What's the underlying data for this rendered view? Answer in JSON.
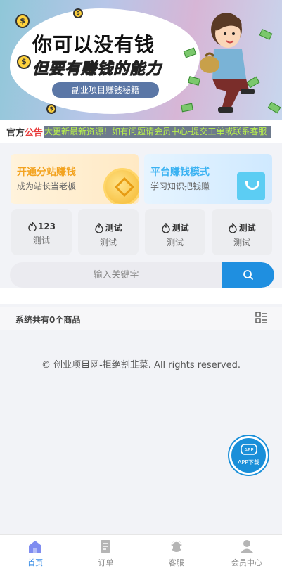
{
  "banner": {
    "title_line1": "你可以没有钱",
    "title_line2": "但要有赚钱的能力",
    "pill": "副业项目赚钱秘籍",
    "coin_symbol": "$"
  },
  "notice": {
    "tag_part1": "官方",
    "tag_part2": "公告",
    "text": "大更新最新资源！如有问题请会员中心-提交工单或联系客服"
  },
  "cards": [
    {
      "title": "开通分站赚钱",
      "subtitle": "成为站长当老板"
    },
    {
      "title": "平台赚钱模式",
      "subtitle": "学习知识把钱赚"
    }
  ],
  "grid": [
    {
      "title": "123",
      "subtitle": "测试"
    },
    {
      "title": "测试",
      "subtitle": "测试"
    },
    {
      "title": "测试",
      "subtitle": "测试"
    },
    {
      "title": "测试",
      "subtitle": "测试"
    }
  ],
  "search": {
    "placeholder": "输入关键字"
  },
  "section": {
    "count_text": "系统共有0个商品"
  },
  "footer": {
    "copyright": "© 创业项目网-拒绝割韭菜. All rights reserved."
  },
  "app_float": {
    "top": "APP",
    "label": "APP下载"
  },
  "tabbar": [
    {
      "label": "首页",
      "icon": "home-icon",
      "active": true
    },
    {
      "label": "订单",
      "icon": "order-icon",
      "active": false
    },
    {
      "label": "客服",
      "icon": "service-icon",
      "active": false
    },
    {
      "label": "会员中心",
      "icon": "user-icon",
      "active": false
    }
  ],
  "colors": {
    "accent": "#1f8fe0",
    "tab_active": "#3a8ee6",
    "notice_text": "#b9f04d"
  }
}
